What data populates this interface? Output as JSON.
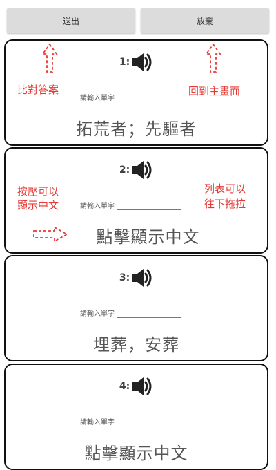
{
  "toolbar": {
    "send_label": "送出",
    "quit_label": "放棄"
  },
  "cards": [
    {
      "number": "1:",
      "input_label": "請輸入單字",
      "input_value": "",
      "answer": "拓荒者；先驅者"
    },
    {
      "number": "2:",
      "input_label": "請輸入單字",
      "input_value": "",
      "answer": "點擊顯示中文"
    },
    {
      "number": "3:",
      "input_label": "請輸入單字",
      "input_value": "",
      "answer": "埋葬，安葬"
    },
    {
      "number": "4:",
      "input_label": "請輸入單字",
      "input_value": "",
      "answer": "點擊顯示中文"
    }
  ],
  "annotations": {
    "compare": "比對答案",
    "home": "回到主畫面",
    "press_line1": "按壓可以",
    "press_line2": "顯示中文",
    "scroll_line1": "列表可以",
    "scroll_line2": "往下拖拉"
  },
  "icons": {
    "speaker": "speaker-icon",
    "arrow": "dashed-arrow-icon"
  },
  "colors": {
    "annotation": "#e53935",
    "button": "#dcdcdc",
    "card_border": "#111111",
    "answer_text": "#555555"
  }
}
